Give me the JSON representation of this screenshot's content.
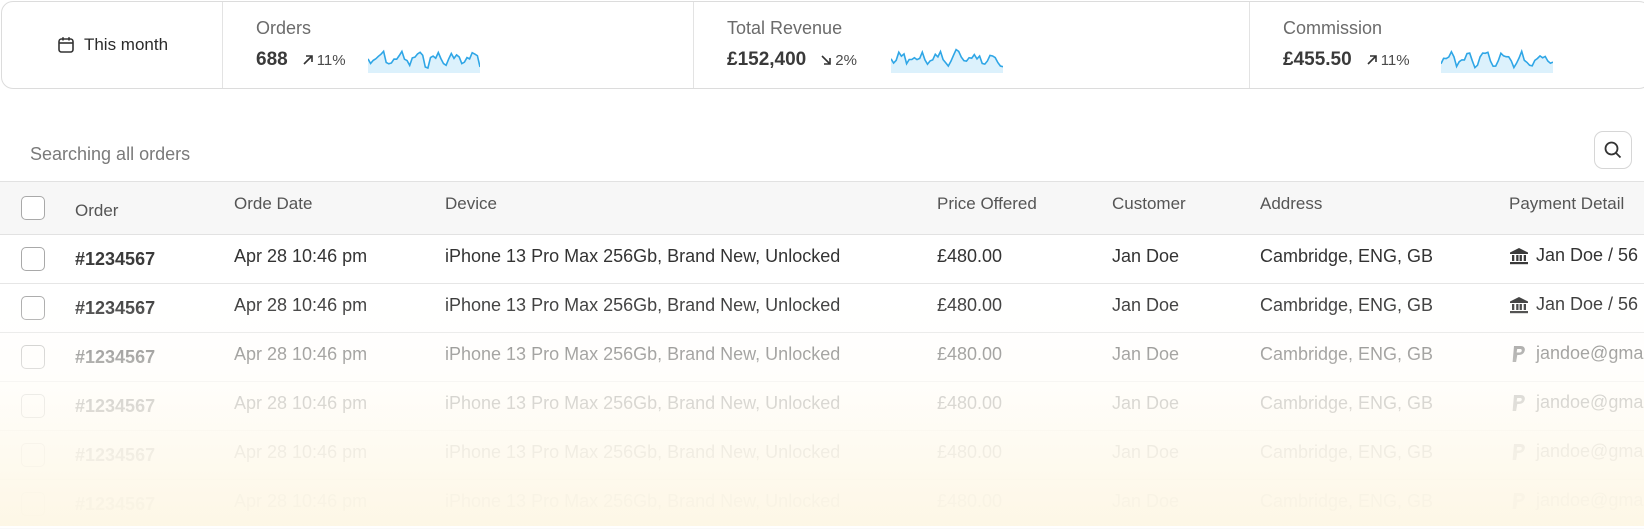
{
  "period": {
    "label": "This month",
    "icon": "calendar-icon"
  },
  "stats": [
    {
      "label": "Orders",
      "value": "688",
      "change": "11%",
      "direction": "up"
    },
    {
      "label": "Total Revenue",
      "value": "£152,400",
      "change": "2%",
      "direction": "down"
    },
    {
      "label": "Commission",
      "value": "£455.50",
      "change": "11%",
      "direction": "up"
    }
  ],
  "search": {
    "placeholder": "Searching all orders",
    "icon": "search-icon"
  },
  "table": {
    "headers": {
      "order": "Order",
      "date": "Orde Date",
      "device": "Device",
      "price": "Price Offered",
      "customer": "Customer",
      "address": "Address",
      "payment": "Payment Detail"
    },
    "rows": [
      {
        "order": "#1234567",
        "date": "Apr 28 10:46 pm",
        "device": "iPhone 13 Pro Max 256Gb, Brand New, Unlocked",
        "price": "£480.00",
        "customer": "Jan Doe",
        "address": "Cambridge, ENG, GB",
        "payment_icon": "bank-icon",
        "payment": "Jan Doe / 56"
      },
      {
        "order": "#1234567",
        "date": "Apr 28 10:46 pm",
        "device": "iPhone 13 Pro Max 256Gb, Brand New, Unlocked",
        "price": "£480.00",
        "customer": "Jan Doe",
        "address": "Cambridge, ENG, GB",
        "payment_icon": "bank-icon",
        "payment": "Jan Doe / 56"
      },
      {
        "order": "#1234567",
        "date": "Apr 28 10:46 pm",
        "device": "iPhone 13 Pro Max 256Gb, Brand New, Unlocked",
        "price": "£480.00",
        "customer": "Jan Doe",
        "address": "Cambridge, ENG, GB",
        "payment_icon": "paypal-icon",
        "payment": "jandoe@gma"
      },
      {
        "order": "#1234567",
        "date": "Apr 28 10:46 pm",
        "device": "iPhone 13 Pro Max 256Gb, Brand New, Unlocked",
        "price": "£480.00",
        "customer": "Jan Doe",
        "address": "Cambridge, ENG, GB",
        "payment_icon": "paypal-icon",
        "payment": "jandoe@gma"
      },
      {
        "order": "#1234567",
        "date": "Apr 28 10:46 pm",
        "device": "iPhone 13 Pro Max 256Gb, Brand New, Unlocked",
        "price": "£480.00",
        "customer": "Jan Doe",
        "address": "Cambridge, ENG, GB",
        "payment_icon": "paypal-icon",
        "payment": "jandoe@gma"
      },
      {
        "order": "#1234567",
        "date": "Apr 28 10:46 pm",
        "device": "iPhone 13 Pro Max 256Gb, Brand New, Unlocked",
        "price": "£480.00",
        "customer": "Jan Doe",
        "address": "Cambridge, ENG, GB",
        "payment_icon": "paypal-icon",
        "payment": "jandoe@gma"
      }
    ]
  },
  "colors": {
    "sparkline": "#2fa6e6",
    "sparkline_fill": "#d6effb",
    "row_fade": "#fdf6e4"
  }
}
